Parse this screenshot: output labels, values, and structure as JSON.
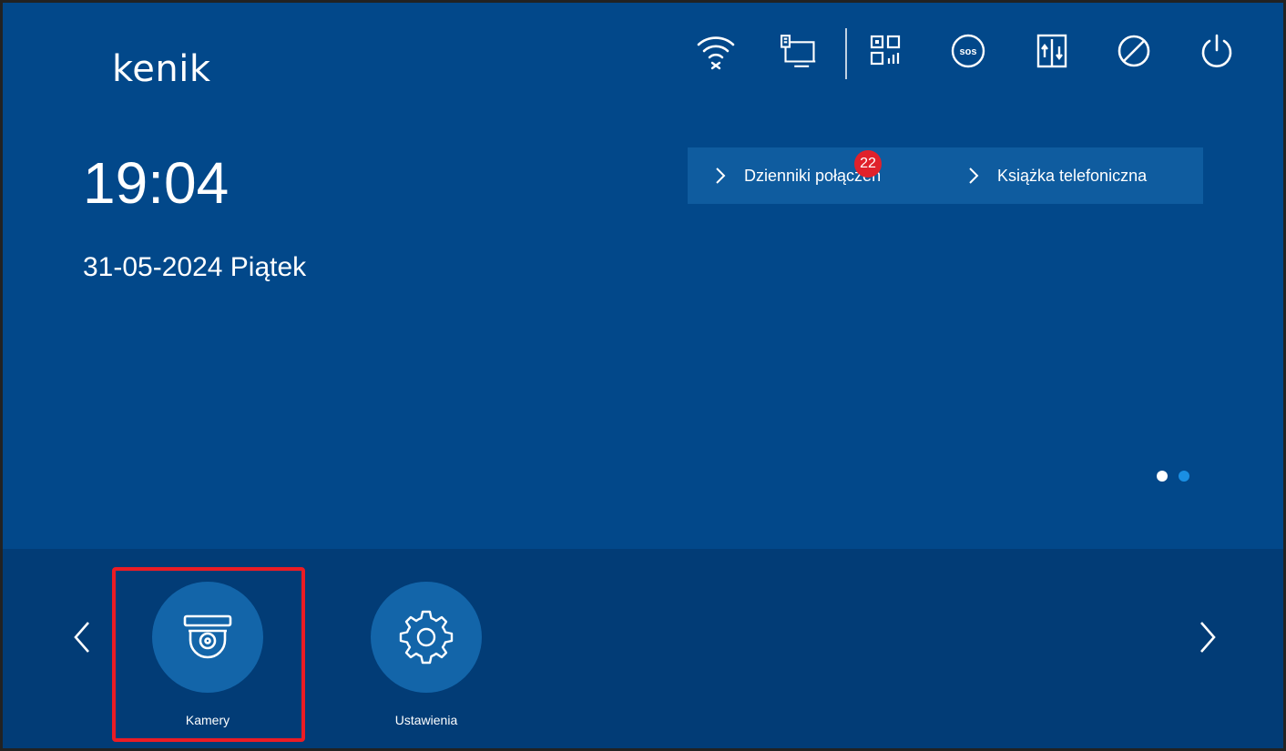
{
  "brand": {
    "logo_text": "kenik"
  },
  "clock": {
    "time": "19:04",
    "date": "31-05-2024 Piątek"
  },
  "status_bar": {
    "icons": [
      "wifi-disconnected-icon",
      "ethernet-icon",
      "qr-code-icon",
      "sos-icon",
      "elevator-icon",
      "do-not-disturb-icon",
      "power-icon"
    ],
    "sos_text": "SOS"
  },
  "quick_links": {
    "call_logs_label": "Dzienniki połączeń",
    "call_logs_badge": "22",
    "phonebook_label": "Książka telefoniczna"
  },
  "pager": {
    "count": 2,
    "active_index": 0
  },
  "apps": [
    {
      "label": "Kamery",
      "icon": "dome-camera-icon",
      "highlighted": true
    },
    {
      "label": "Ustawienia",
      "icon": "gear-icon",
      "highlighted": false
    }
  ],
  "colors": {
    "background": "#02488a",
    "bottom_bar": "#023c76",
    "quick_links_bg": "#0f5c9f",
    "app_circle": "#1365a9",
    "badge": "#e0212b",
    "highlight": "#ec1c24",
    "pager_active": "#ffffff",
    "pager_inactive": "#1a8fe3"
  }
}
